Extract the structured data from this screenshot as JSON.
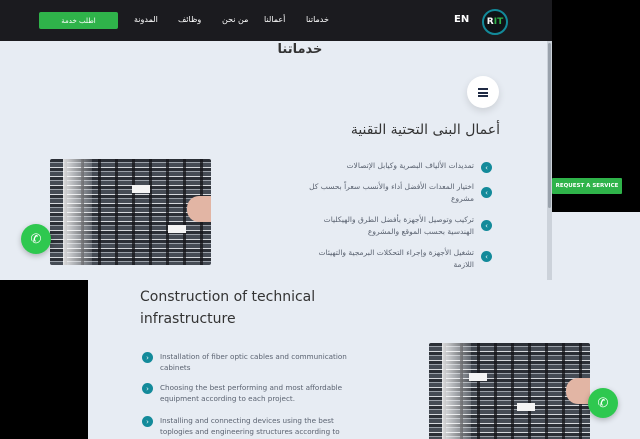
{
  "arabic": {
    "nav": {
      "cta": "اطلب خدمة",
      "links": [
        "المدونة",
        "وظائف",
        "من نحن",
        "أعمالنا",
        "خدماتنا"
      ],
      "lang": "EN",
      "logo": {
        "prefix": "R",
        "accent": "IT"
      }
    },
    "section_title": "خدماتنا",
    "heading": "أعمال البنى التحتية التقنية",
    "items": [
      "تمديدات الألياف البصرية وكيابل الإتصالات",
      "اختيار المعدات الأفضل أداء والأنسب سعراً بحسب كل مشروع",
      "تركيب وتوصيل الأجهزة بأفضل الطرق والهيكليات الهندسية بحسب الموقع والمشروع",
      "تشغيل الأجهزة وإجراء التحكلات البرمجية والتهيئات اللازمة"
    ],
    "whatsapp_icon": "whatsapp-icon"
  },
  "side_button": "REQUEST A SERVICE",
  "english": {
    "heading": "Construction of technical infrastructure",
    "items": [
      "Installation of fiber optic cables and communication cabinets",
      "Choosing the best performing and most affordable equipment according to each project.",
      "Installing and connecting devices using the best toplogies and engineering structures according to"
    ],
    "whatsapp_icon": "whatsapp-icon"
  },
  "colors": {
    "accent_green": "#2fb34a",
    "teal": "#138a9a",
    "nav_dark": "#1b1b1f",
    "page_bg": "#e7ecf3"
  }
}
